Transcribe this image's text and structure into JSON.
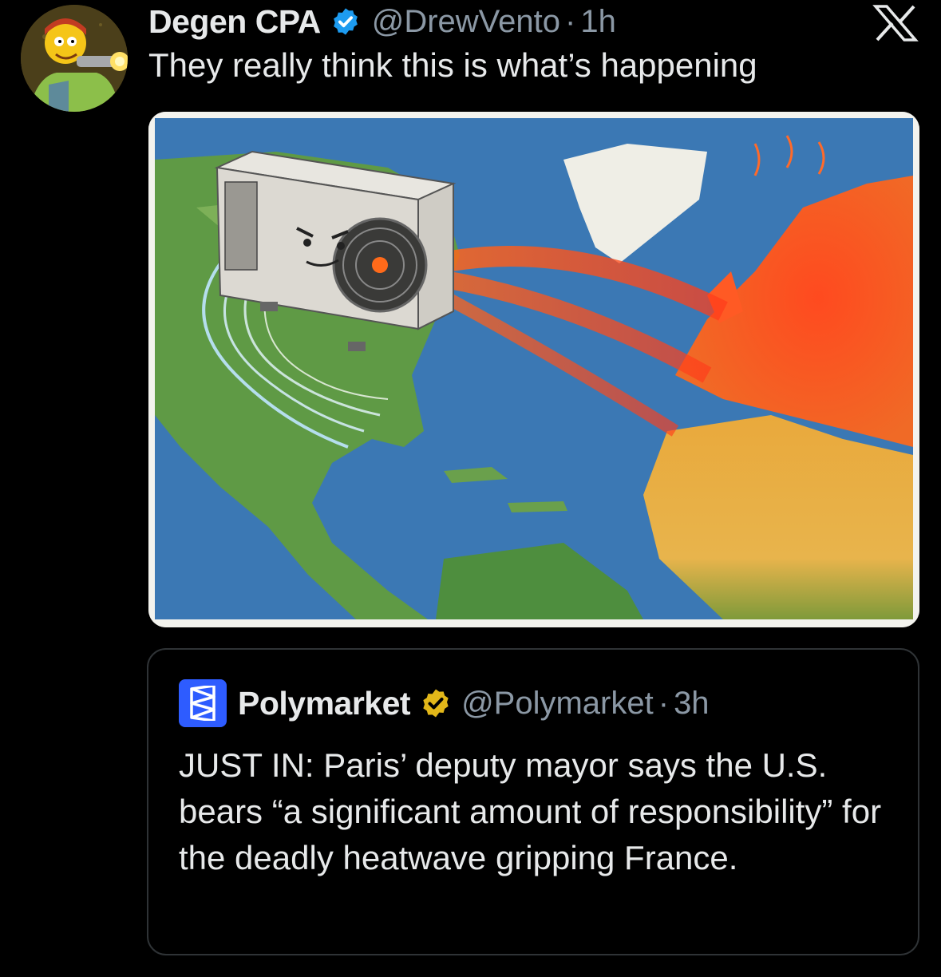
{
  "tweet": {
    "author_name": "Degen CPA",
    "author_handle": "@DrewVento",
    "separator": "·",
    "time": "1h",
    "text": "They really think this is what’s happening",
    "avatar_icon": "cartoon-avatar",
    "verified_icon": "verified-badge-blue",
    "verified_color": "#1d9bf0"
  },
  "app": {
    "logo_icon": "x-logo"
  },
  "media": {
    "image_icon": "map-image-air-conditioner-heatwave"
  },
  "quoted": {
    "author_name": "Polymarket",
    "author_handle": "@Polymarket",
    "separator": "·",
    "time": "3h",
    "text": "JUST IN: Paris’ deputy mayor says the U.S. bears “a significant amount of responsibility” for the deadly heatwave gripping France.",
    "logo_icon": "polymarket-logo",
    "logo_color": "#2e5cff",
    "verified_icon": "verified-badge-gold",
    "verified_color": "#e2b719"
  },
  "colors": {
    "background": "#000000",
    "text_primary": "#e7e9ea",
    "text_secondary": "#8b98a5",
    "border": "#2f3336"
  }
}
